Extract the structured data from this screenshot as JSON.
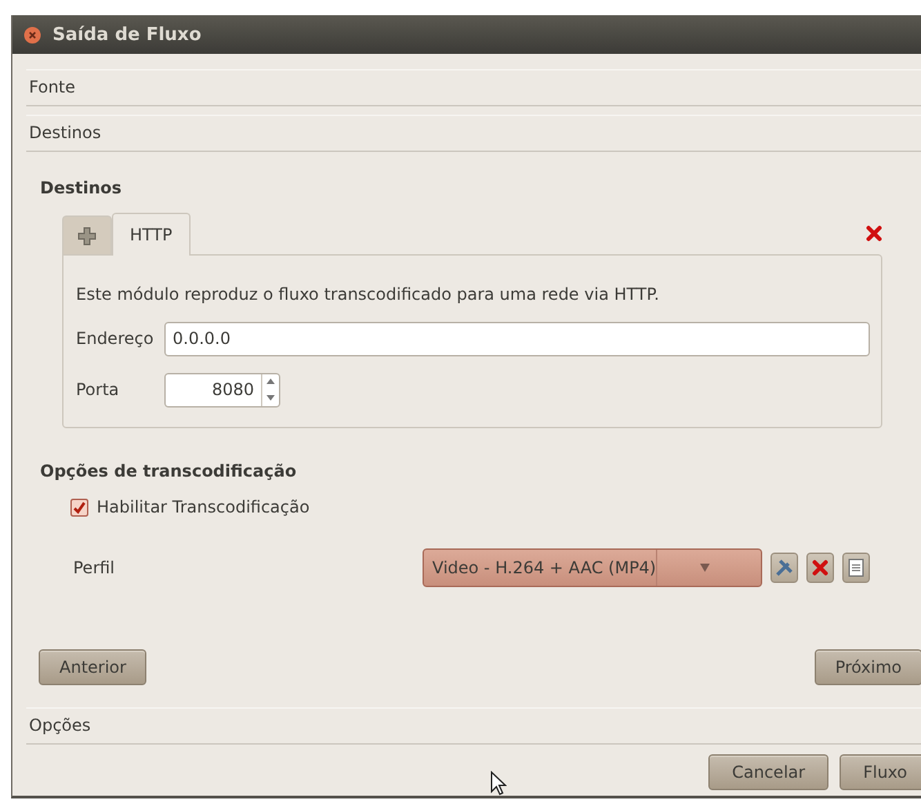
{
  "window": {
    "title": "Saída de Fluxo"
  },
  "sections": [
    {
      "label": "Fonte"
    },
    {
      "label": "Destinos"
    }
  ],
  "destinations": {
    "heading": "Destinos",
    "tabs": [
      {
        "kind": "add",
        "selected": false
      },
      {
        "kind": "label",
        "label": "HTTP",
        "selected": true
      }
    ],
    "description": "Este módulo reproduz o fluxo transcodificado para uma rede via HTTP.",
    "fields": [
      {
        "kind": "text",
        "label": "Endereço",
        "value": "0.0.0.0"
      },
      {
        "kind": "spin",
        "label": "Porta",
        "value": "8080"
      }
    ]
  },
  "transcoding": {
    "heading": "Opções de transcodificação",
    "enable": {
      "label": "Habilitar Transcodificação",
      "checked": true
    },
    "profile": {
      "label": "Perfil",
      "value": "Video - H.264 + AAC (MP4)"
    }
  },
  "nav_buttons": [
    "Anterior",
    "Próximo"
  ],
  "options_section": {
    "label": "Opções"
  },
  "buttons": [
    "Cancelar",
    "Fluxo"
  ]
}
